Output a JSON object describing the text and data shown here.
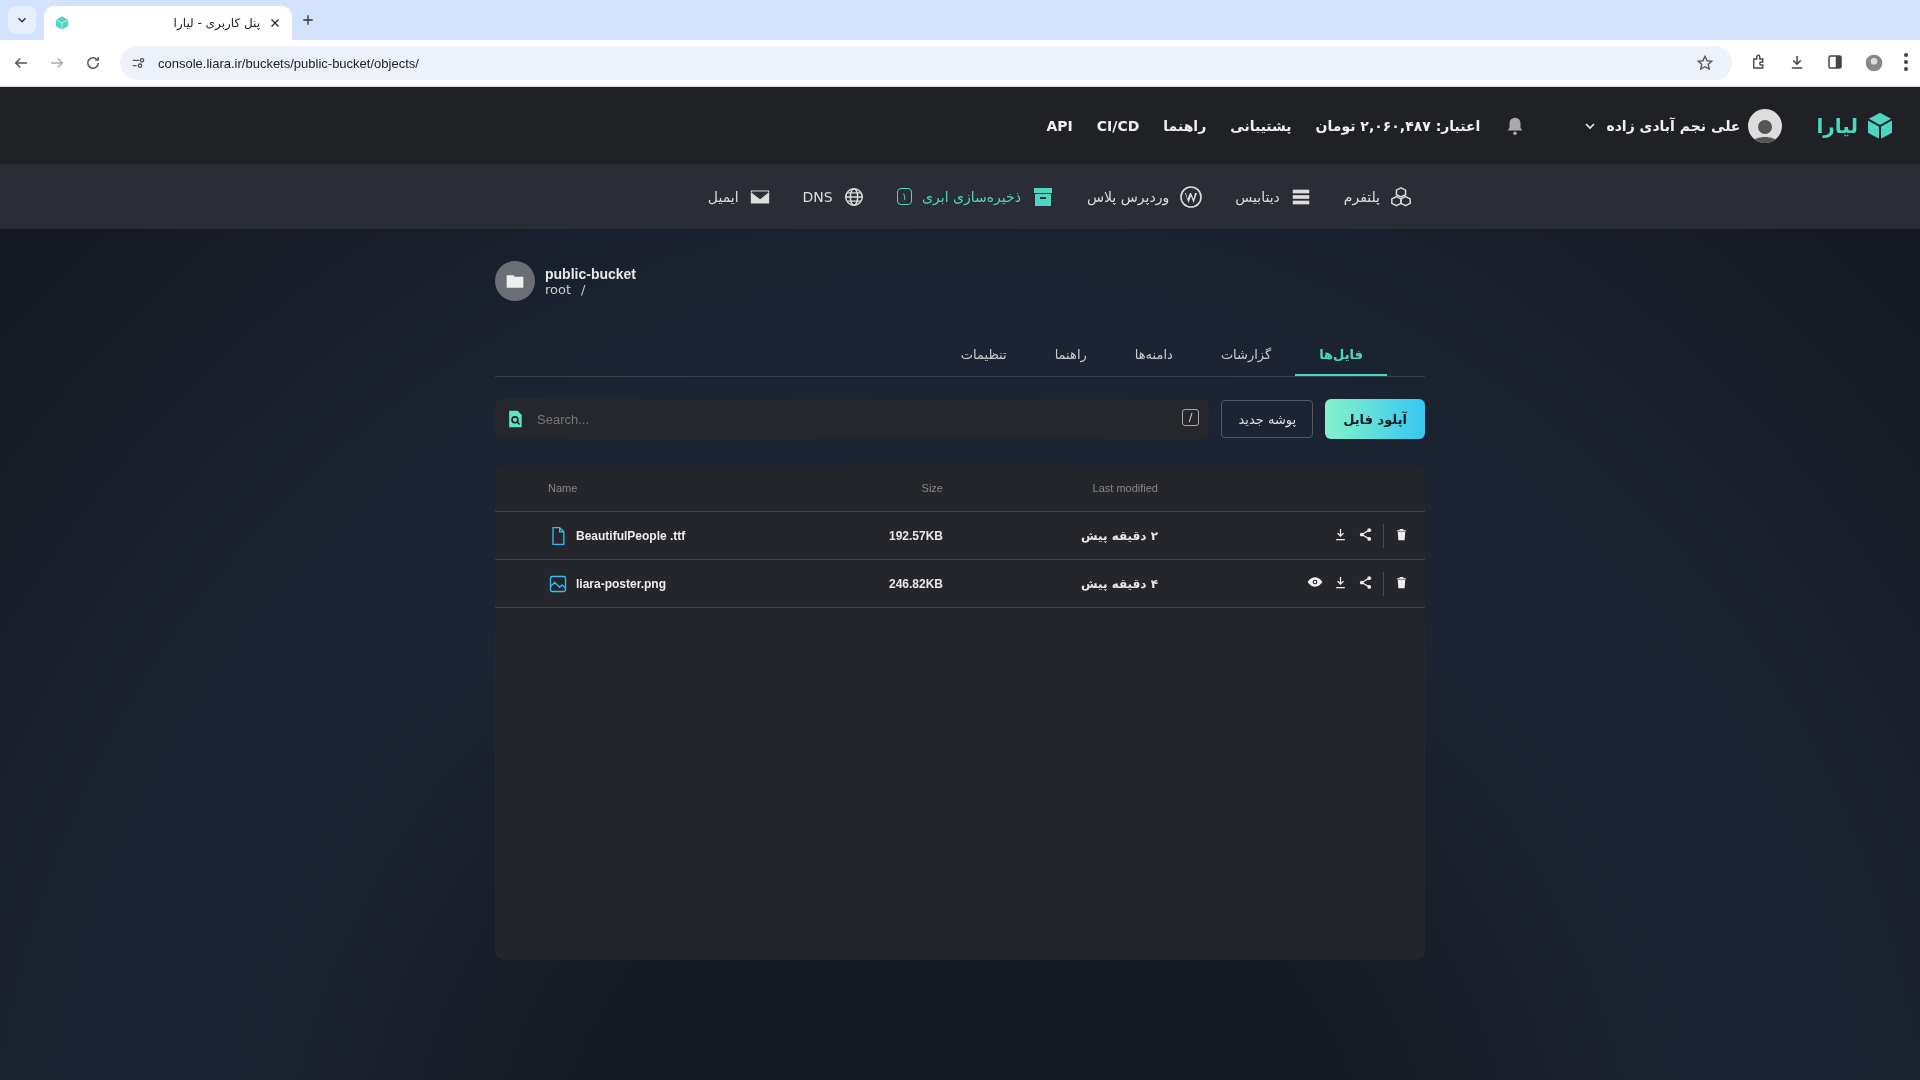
{
  "browser": {
    "tab_title": "پنل کاربری - لیارا",
    "url": "console.liara.ir/buckets/public-bucket/objects/"
  },
  "header": {
    "brand": "لیارا",
    "user_name": "علی نجم آبادی زاده",
    "credit": "اعتبار: ۲,۰۶۰,۴۸۷ تومان",
    "links": [
      "پشتیبانی",
      "راهنما",
      "CI/CD",
      "API"
    ]
  },
  "nav": [
    {
      "kind": "platform",
      "label": "پلتفرم",
      "selected": false
    },
    {
      "kind": "database",
      "label": "دیتابیس",
      "selected": false
    },
    {
      "kind": "wordpress",
      "label": "وردپرس پلاس",
      "selected": false
    },
    {
      "kind": "storage",
      "label": "ذخیره‌سازی ابری",
      "selected": true,
      "badge": "۱"
    },
    {
      "kind": "dns",
      "label": "DNS",
      "selected": false
    },
    {
      "kind": "email",
      "label": "ایمیل",
      "selected": false
    }
  ],
  "bucket": {
    "name": "public-bucket",
    "path": "root",
    "separator": "/"
  },
  "tabs": [
    {
      "label": "فایل‌ها",
      "selected": true
    },
    {
      "label": "گزارشات",
      "selected": false
    },
    {
      "label": "دامنه‌ها",
      "selected": false
    },
    {
      "label": "راهنما",
      "selected": false
    },
    {
      "label": "تنظیمات",
      "selected": false
    }
  ],
  "toolbar": {
    "upload": "آپلود فایل",
    "new_folder": "پوشه جدید",
    "search": {
      "placeholder": "Search...",
      "shortcut": "/"
    }
  },
  "table": {
    "headers": {
      "name": "Name",
      "size": "Size",
      "modified": "Last modified"
    },
    "rows": [
      {
        "kind": "file",
        "name": "BeautifulPeople .ttf",
        "size": "192.57KB",
        "modified": "۲ دقیقه پیش"
      },
      {
        "kind": "image",
        "name": "liara-poster.png",
        "size": "246.82KB",
        "modified": "۴ دقیقه پیش"
      }
    ]
  }
}
